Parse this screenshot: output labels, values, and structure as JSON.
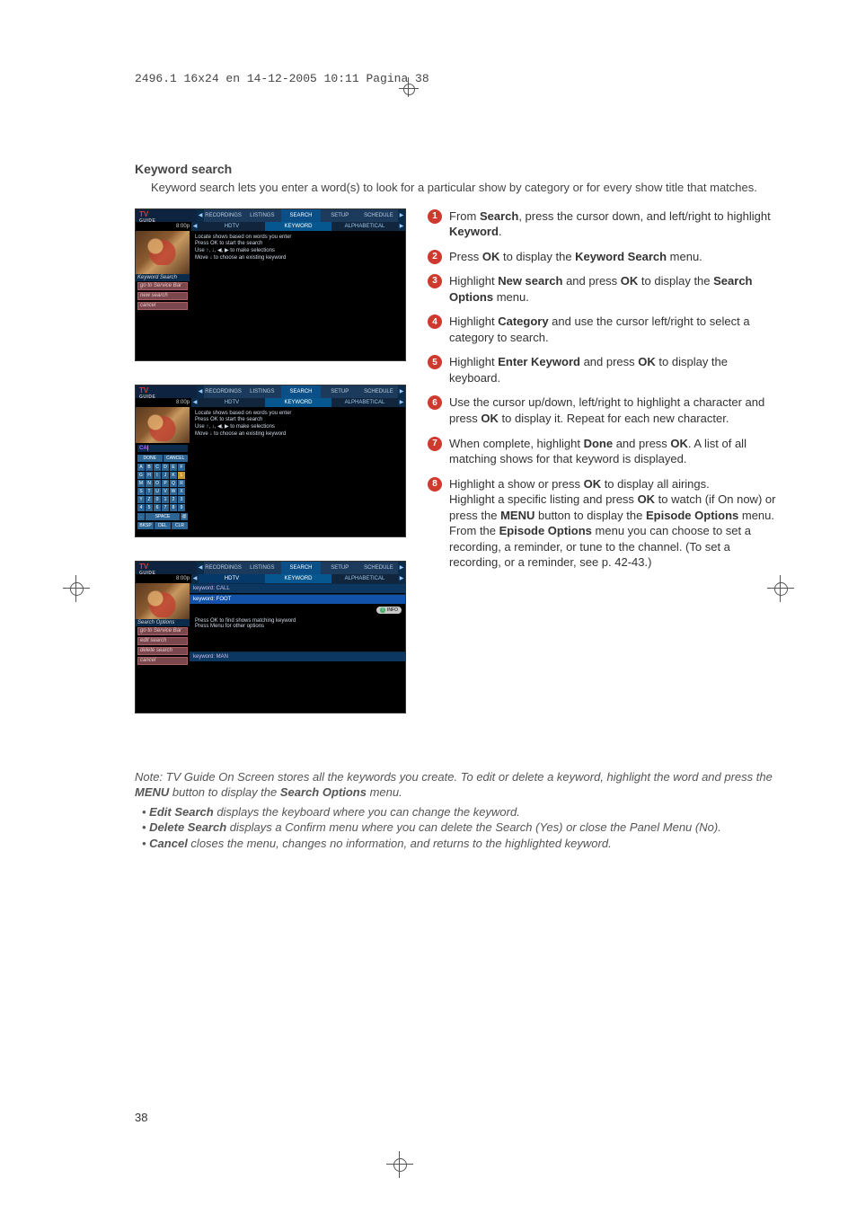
{
  "print_header": "2496.1 16x24 en  14-12-2005  10:11  Pagina 38",
  "page_number": "38",
  "section_title": "Keyword search",
  "intro": "Keyword search lets you enter a word(s) to look for a particular show by category or for every show title that matches.",
  "tv_common": {
    "logo_top": "TV",
    "logo_bottom": "GUIDE",
    "time": "8:00p",
    "tabs": [
      "RECORDINGS",
      "LISTINGS",
      "SEARCH",
      "SETUP",
      "SCHEDULE"
    ],
    "subtabs": [
      "HDTV",
      "KEYWORD",
      "ALPHABETICAL"
    ],
    "arrow_left": "◀",
    "arrow_right": "▶"
  },
  "panel1": {
    "side_menu_title": "Keyword Search",
    "side_menu_items": [
      "go to Service Bar",
      "new search",
      "cancel"
    ],
    "help_lines": [
      "Locate shows based on words you enter",
      "Press OK to start the search",
      "Use ↑, ↓, ◀, ▶ to make selections",
      "Move ↓ to choose an existing keyword"
    ]
  },
  "panel2": {
    "input_value": "CA",
    "kb_row_top": [
      "DONE",
      "CANCEL"
    ],
    "kb_rows": [
      [
        "A",
        "B",
        "C",
        "D",
        "E",
        "F"
      ],
      [
        "G",
        "H",
        "I",
        "J",
        "K",
        "L"
      ],
      [
        "M",
        "N",
        "O",
        "P",
        "Q",
        "R"
      ],
      [
        "S",
        "T",
        "U",
        "V",
        "W",
        "X"
      ],
      [
        "Y",
        "Z",
        "0",
        "1",
        "2",
        "3"
      ],
      [
        "4",
        "5",
        "6",
        "7",
        "8",
        "9"
      ]
    ],
    "kb_row_space": [
      ".",
      "SPACE",
      "@"
    ],
    "kb_row_bottom": [
      "BKSP",
      "DEL",
      "CLR"
    ],
    "help_lines": [
      "Locate shows based on words you enter",
      "Press OK to start the search",
      "Use ↑, ↓, ◀, ▶ to make selections",
      "Move ↓ to choose an existing keyword"
    ]
  },
  "panel3": {
    "side_menu_title": "Search Options",
    "side_menu_items": [
      "go to Service Bar",
      "edit search",
      "delete search",
      "cancel"
    ],
    "help_lines": [
      "Press OK to find shows matching keyword",
      "Press Menu for other options"
    ],
    "info_label": "INFO",
    "keyword_rows": [
      "keyword: CALL",
      "keyword: FOOT",
      "keyword: MAN"
    ]
  },
  "steps": [
    {
      "n": "1",
      "html": "From <b>Search</b>, press the cursor down, and left/right to highlight <b>Keyword</b>."
    },
    {
      "n": "2",
      "html": "Press <b>OK</b> to display the <b>Keyword Search</b> menu."
    },
    {
      "n": "3",
      "html": "Highlight <b>New search</b> and press <b>OK</b> to display the <b>Search Options</b> menu."
    },
    {
      "n": "4",
      "html": "Highlight <b>Category</b> and use the cursor left/right to select a category to search."
    },
    {
      "n": "5",
      "html": "Highlight <b>Enter Keyword</b> and press <b>OK</b> to display the keyboard."
    },
    {
      "n": "6",
      "html": "Use the cursor up/down, left/right to highlight a character and press <b>OK</b> to display it. Repeat for each new character."
    },
    {
      "n": "7",
      "html": "When complete, highlight <b>Done</b> and press <b>OK</b>. A list of all matching shows for that keyword is displayed."
    },
    {
      "n": "8",
      "html": "Highlight a show or press <b>OK</b> to display all airings.<br>Highlight a specific listing and press <b>OK</b> to watch (if On now) or press the <b>MENU</b> button to display the <b>Episode Options</b> menu.  From the <b>Episode Options</b> menu you can choose to set a recording, a reminder, or tune to the channel. (To set a recording, or a reminder, see p. 42-43.)"
    }
  ],
  "note": {
    "lead": "Note: TV Guide On Screen stores all the keywords you create. To edit or delete a keyword, highlight the word and press the <b>MENU</b> button to display the <b>Search Options</b> menu.",
    "bullets": [
      "<b>Edit Search</b> displays the keyboard where you can change the keyword.",
      "<b>Delete Search</b> displays a Confirm menu where you can delete the Search (Yes) or close the Panel Menu (No).",
      "<b>Cancel</b> closes the menu, changes no information, and returns to the highlighted keyword."
    ]
  }
}
